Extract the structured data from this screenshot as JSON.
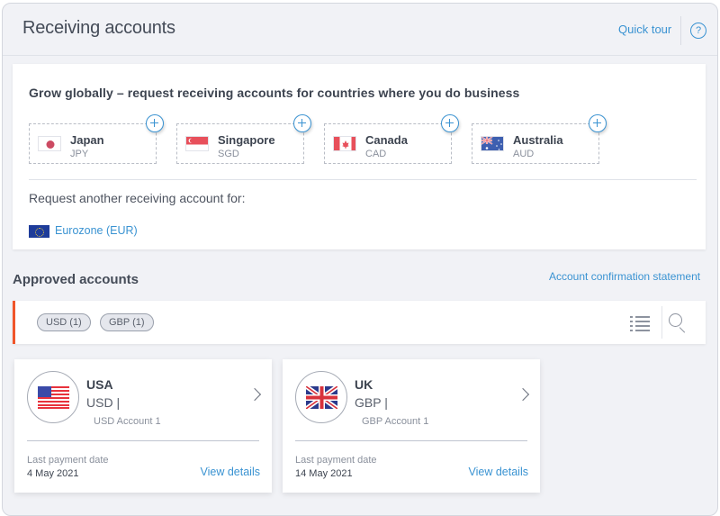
{
  "header": {
    "title": "Receiving accounts",
    "quick_tour": "Quick tour",
    "help_icon": "?"
  },
  "grow": {
    "title": "Grow globally – request receiving accounts for countries where you do business",
    "countries": [
      {
        "name": "Japan",
        "code": "JPY",
        "flag": "japan-flag"
      },
      {
        "name": "Singapore",
        "code": "SGD",
        "flag": "singapore-flag"
      },
      {
        "name": "Canada",
        "code": "CAD",
        "flag": "canada-flag"
      },
      {
        "name": "Australia",
        "code": "AUD",
        "flag": "australia-flag"
      }
    ],
    "request_label": "Request another receiving account for:",
    "eurozone_link": "Eurozone (EUR)"
  },
  "approved": {
    "title": "Approved accounts",
    "statement_link": "Account confirmation statement",
    "filters": [
      "USD (1)",
      "GBP (1)"
    ],
    "accounts": [
      {
        "country": "USA",
        "currency": "USD |",
        "account_name": "USD Account 1",
        "last_payment_label": "Last payment date",
        "last_payment_date": "4 May 2021",
        "view_details": "View details",
        "flag": "usa-flag"
      },
      {
        "country": "UK",
        "currency": "GBP |",
        "account_name": "GBP Account 1",
        "last_payment_label": "Last payment date",
        "last_payment_date": "14 May 2021",
        "view_details": "View details",
        "flag": "uk-flag"
      }
    ]
  },
  "colors": {
    "accent": "#3a93d2",
    "filter_bar_accent": "#f0552a",
    "page_background": "#f1f2f6"
  }
}
